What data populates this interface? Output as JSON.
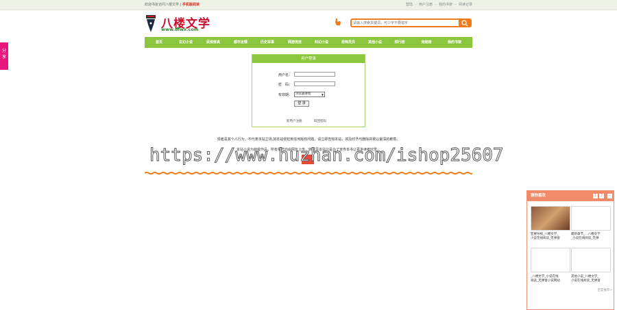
{
  "topbar": {
    "welcome": "欢迎书友访问八楼文学",
    "separator": "|",
    "mobile": "手机版阅读",
    "links": [
      "登陆",
      "-",
      "用户注册",
      "-",
      "我的书架",
      "-",
      "阅读记录"
    ]
  },
  "logo": {
    "name": "八楼文学",
    "url": "www.8lwx.com"
  },
  "search": {
    "placeholder": "请输入搜索关键词，可少字不要错字"
  },
  "nav": [
    "首页",
    "玄幻小说",
    "武侠修真",
    "都市言情",
    "历史军事",
    "网游竞技",
    "科幻小说",
    "恐怖灵异",
    "其他小说",
    "排行榜",
    "完结榜",
    "我的书架"
  ],
  "login": {
    "title": "用户登录",
    "username_label": "用户名：",
    "password_label": "密　码：",
    "expiry_label": "有效期：",
    "expiry_value": "浏览器进程",
    "submit": "登 录",
    "register": "新用户注册",
    "forgot": "取回密码"
  },
  "notice": {
    "line1": "观者喜其个人行为，不代表本站立场,如本站侵犯到任何版权问题，请立即告知本站，将及时予与删除并致以最深的歉意。",
    "line2": "本站小说为转载作品，所有章节均由网友上传，转载至本站只是为了宣传本书让更多读者欣赏。"
  },
  "watermark": "https://www.huzhan.com/ishop25607",
  "share": "分享",
  "recommend": {
    "title": "猜你喜欢",
    "controls": [
      "1",
      "2",
      "−"
    ],
    "items": [
      {
        "line1": "亚楼导视_八楼文学_",
        "line2": "小说在线阅读_无弹窗"
      },
      {
        "line1": "最新章节_...八楼文学",
        "line2": "_小说在线阅读_无弹"
      },
      {
        "line1": "_八楼文学_小说在线",
        "line2": "阅读_无弹窗小说网站"
      },
      {
        "line1": "其他小说_八楼文学_",
        "line2": "小说在线阅读_无弹窗"
      }
    ],
    "more": "百度推荐>"
  },
  "colors": {
    "nav_green": "#8cc63f",
    "accent_orange": "#f07b1a",
    "brand_red": "#c8102e",
    "share_pink": "#e8177d",
    "rec_header": "#f08a68"
  }
}
